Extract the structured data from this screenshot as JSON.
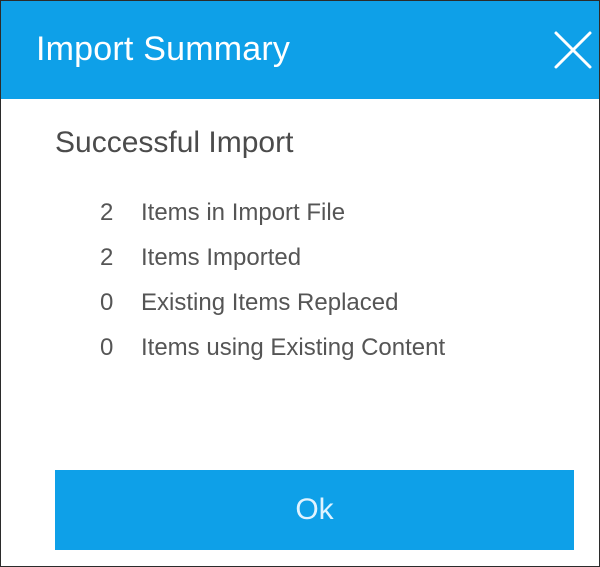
{
  "dialog": {
    "title": "Import Summary",
    "subtitle": "Successful Import",
    "close_icon": "close-icon",
    "stats": [
      {
        "count": "2",
        "label": "Items in Import File"
      },
      {
        "count": "2",
        "label": "Items Imported"
      },
      {
        "count": "0",
        "label": "Existing Items Replaced"
      },
      {
        "count": "0",
        "label": "Items using Existing Content"
      }
    ],
    "ok_label": "Ok",
    "colors": {
      "accent": "#0ea0e8",
      "text": "#555555"
    }
  }
}
